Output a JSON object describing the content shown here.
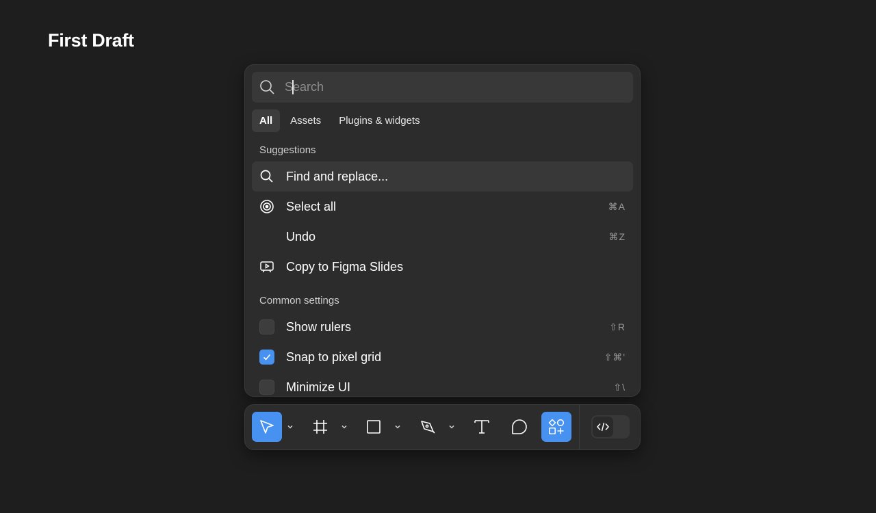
{
  "document": {
    "title": "First Draft"
  },
  "search": {
    "placeholder": "Search",
    "value": ""
  },
  "tabs": [
    {
      "label": "All",
      "active": true
    },
    {
      "label": "Assets",
      "active": false
    },
    {
      "label": "Plugins & widgets",
      "active": false
    }
  ],
  "suggestions": {
    "heading": "Suggestions",
    "items": [
      {
        "label": "Find and replace...",
        "icon": "search-icon",
        "shortcut": ""
      },
      {
        "label": "Select all",
        "icon": "target-icon",
        "shortcut": "⌘A"
      },
      {
        "label": "Undo",
        "icon": "",
        "shortcut": "⌘Z"
      },
      {
        "label": "Copy to Figma Slides",
        "icon": "slides-icon",
        "shortcut": ""
      }
    ]
  },
  "common_settings": {
    "heading": "Common settings",
    "items": [
      {
        "label": "Show rulers",
        "checked": false,
        "shortcut": "⇧R"
      },
      {
        "label": "Snap to pixel grid",
        "checked": true,
        "shortcut": "⇧⌘'"
      },
      {
        "label": "Minimize UI",
        "checked": false,
        "shortcut": "⇧\\"
      }
    ]
  },
  "toolbar": {
    "tools": [
      {
        "name": "move-tool",
        "icon": "cursor-icon",
        "active": true
      },
      {
        "name": "frame-tool",
        "icon": "frame-icon",
        "active": false
      },
      {
        "name": "shape-tool",
        "icon": "rectangle-icon",
        "active": false
      },
      {
        "name": "pen-tool",
        "icon": "pen-icon",
        "active": false
      },
      {
        "name": "text-tool",
        "icon": "text-icon",
        "active": false
      },
      {
        "name": "comment-tool",
        "icon": "comment-icon",
        "active": false
      },
      {
        "name": "actions-tool",
        "icon": "shapes-plus-icon",
        "active": true
      }
    ],
    "dev_mode": {
      "icon": "code-icon",
      "on": false
    }
  },
  "colors": {
    "background": "#1e1e1e",
    "panel": "#2c2c2c",
    "accent": "#4791f0"
  }
}
